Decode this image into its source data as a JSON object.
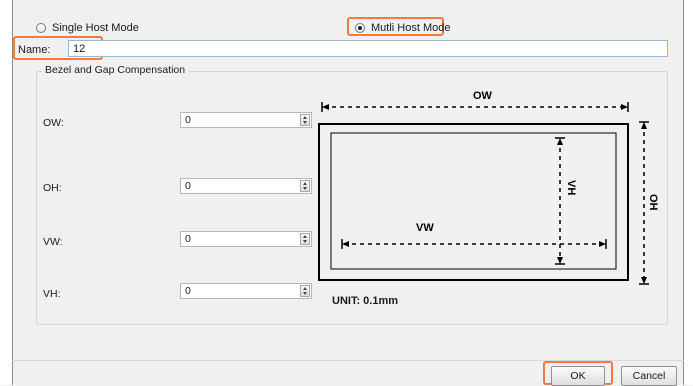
{
  "mode": {
    "single_label": "Single Host Mode",
    "multi_label": "Mutli Host Mode",
    "selected": "multi"
  },
  "name": {
    "label": "Name:",
    "value": "12"
  },
  "group_title": "Bezel and Gap Compensation",
  "fields": [
    {
      "label": "OW:",
      "value": "0"
    },
    {
      "label": "OH:",
      "value": "0"
    },
    {
      "label": "VW:",
      "value": "0"
    },
    {
      "label": "VH:",
      "value": "0"
    }
  ],
  "diagram": {
    "ow": "OW",
    "oh": "OH",
    "vw": "VW",
    "vh": "VH"
  },
  "unit": "UNIT: 0.1mm",
  "buttons": {
    "ok": "OK",
    "cancel": "Cancel"
  },
  "colors": {
    "highlight": "#ef7b3c",
    "input_border": "#9ab8d4"
  }
}
